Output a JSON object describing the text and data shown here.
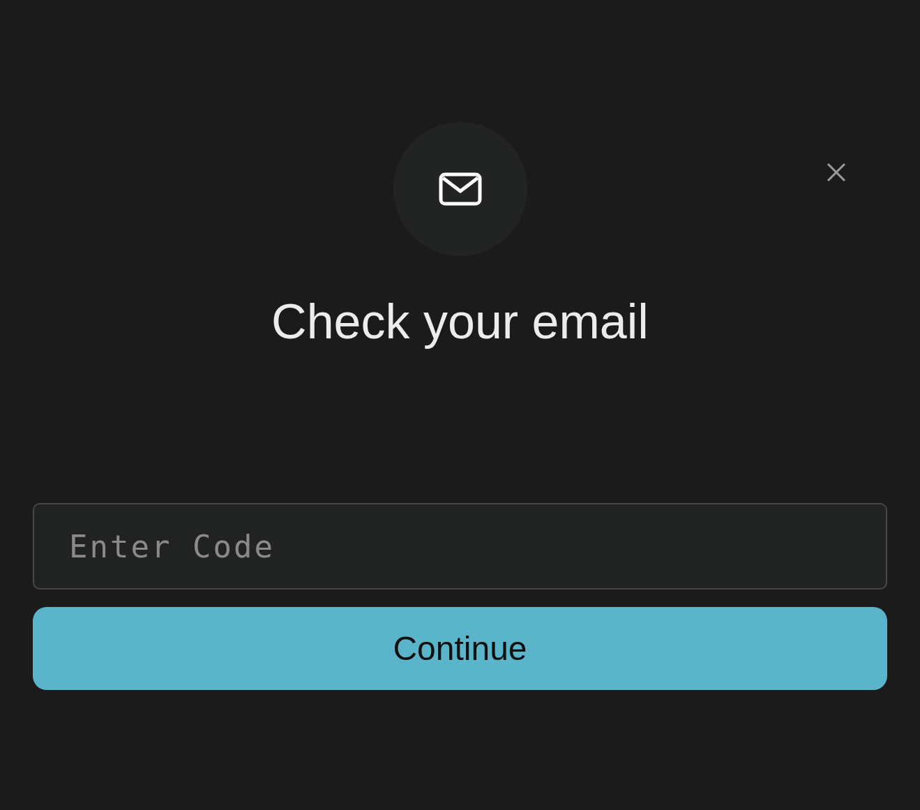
{
  "dialog": {
    "title": "Check your email",
    "code_field": {
      "placeholder": "Enter Code"
    },
    "continue_button": {
      "label": "Continue"
    }
  }
}
